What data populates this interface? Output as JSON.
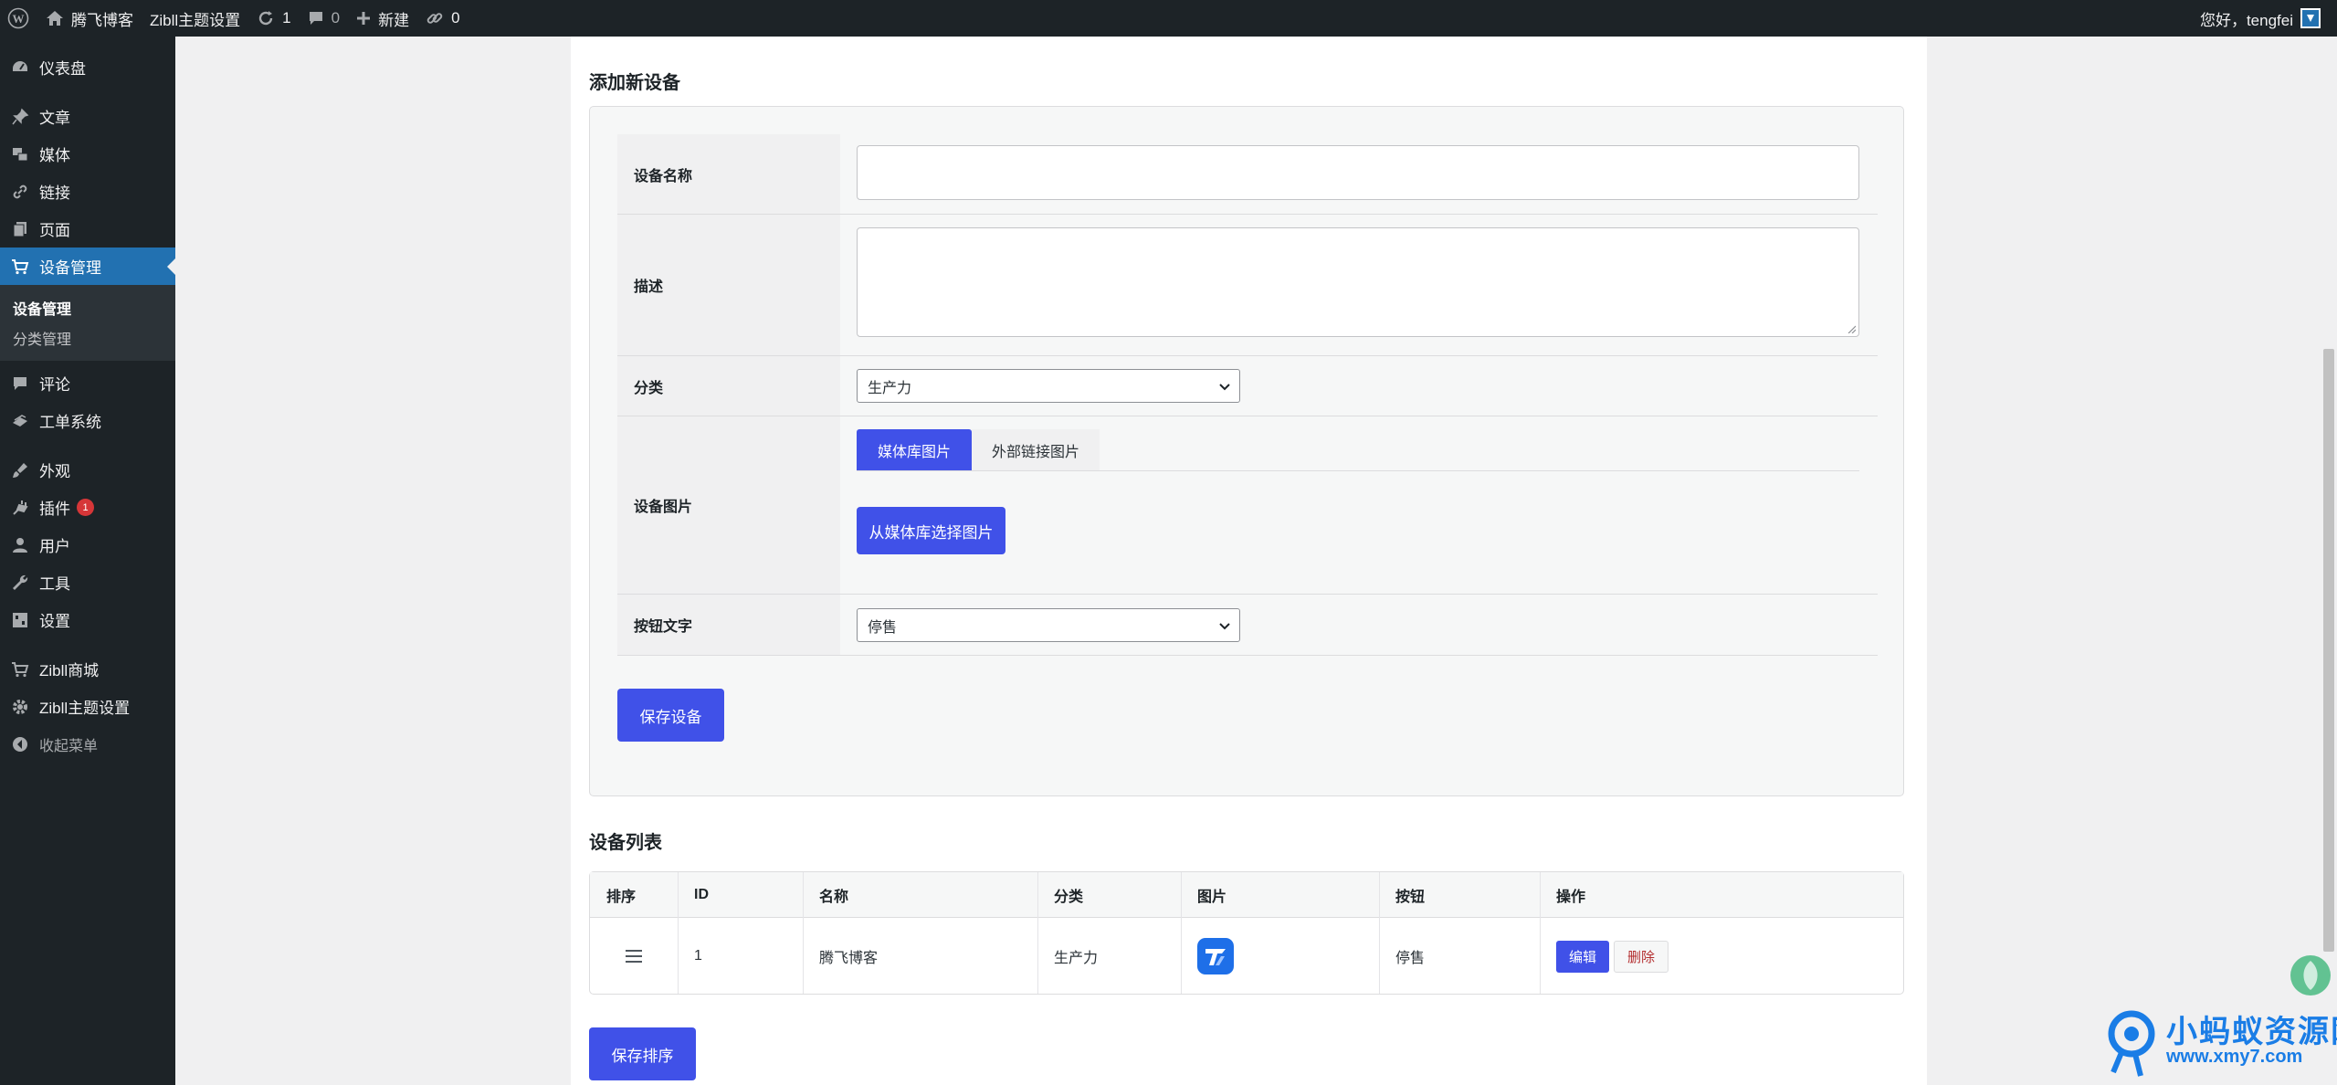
{
  "adminbar": {
    "site_name": "腾飞博客",
    "theme_settings": "Zibll主题设置",
    "updates_count": "1",
    "comments_count": "0",
    "new_label": "新建",
    "links_count": "0",
    "greeting": "您好，tengfei"
  },
  "sidebar": {
    "dashboard": "仪表盘",
    "posts": "文章",
    "media": "媒体",
    "links": "链接",
    "pages": "页面",
    "device_mgmt": "设备管理",
    "sub_device_mgmt": "设备管理",
    "sub_category_mgmt": "分类管理",
    "comments": "评论",
    "ticket_system": "工单系统",
    "appearance": "外观",
    "plugins": "插件",
    "plugins_badge": "1",
    "users": "用户",
    "tools": "工具",
    "settings": "设置",
    "zibll_shop": "Zibll商城",
    "zibll_theme": "Zibll主题设置",
    "collapse": "收起菜单"
  },
  "form": {
    "section_title": "添加新设备",
    "name_label": "设备名称",
    "name_value": "",
    "desc_label": "描述",
    "desc_value": "",
    "category_label": "分类",
    "category_value": "生产力",
    "image_label": "设备图片",
    "tab_media": "媒体库图片",
    "tab_external": "外部链接图片",
    "choose_media_btn": "从媒体库选择图片",
    "button_text_label": "按钮文字",
    "button_text_value": "停售",
    "save_btn": "保存设备"
  },
  "list": {
    "section_title": "设备列表",
    "headers": [
      "排序",
      "ID",
      "名称",
      "分类",
      "图片",
      "按钮",
      "操作"
    ],
    "rows": [
      {
        "id": "1",
        "name": "腾飞博客",
        "category": "生产力",
        "button": "停售",
        "edit": "编辑",
        "delete": "删除"
      }
    ],
    "save_order_btn": "保存排序"
  },
  "watermark": {
    "text_cn": "小蚂蚁资源网",
    "text_url": "www.xmy7.com"
  },
  "colors": {
    "accent": "#4051e8",
    "admin_dark": "#1d2327",
    "admin_active": "#2271b1",
    "danger": "#d63638"
  }
}
